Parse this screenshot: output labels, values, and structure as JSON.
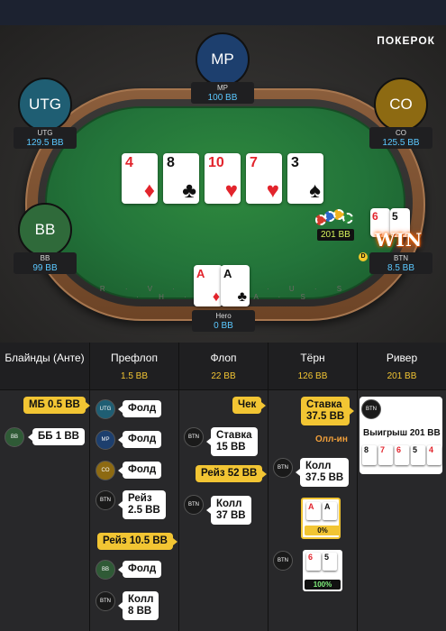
{
  "brand": "ПОКЕРОК",
  "rail_text": "R · V · S · P · U · S · H · C · A · S",
  "players": {
    "mp": {
      "abbr": "MP",
      "name": "MP",
      "stack": "100 BB",
      "color": "#1d3f6e"
    },
    "utg": {
      "abbr": "UTG",
      "name": "UTG",
      "stack": "129.5 BB",
      "color": "#1f5e73"
    },
    "co": {
      "abbr": "CO",
      "name": "CO",
      "stack": "125.5 BB",
      "color": "#8d6a12"
    },
    "bb": {
      "abbr": "BB",
      "name": "BB",
      "stack": "99 BB",
      "color": "#2f6a3a"
    },
    "btn": {
      "name": "BTN",
      "stack": "8.5 BB"
    },
    "hero": {
      "name": "Hero",
      "stack": "0 BB"
    }
  },
  "board": [
    {
      "rank": "4",
      "suit": "♦",
      "color": "red"
    },
    {
      "rank": "8",
      "suit": "♣",
      "color": "blk"
    },
    {
      "rank": "10",
      "suit": "♥",
      "color": "red"
    },
    {
      "rank": "7",
      "suit": "♥",
      "color": "red"
    },
    {
      "rank": "3",
      "suit": "♠",
      "color": "blk"
    }
  ],
  "hero_cards": [
    {
      "rank": "A",
      "suit": "♦",
      "color": "red"
    },
    {
      "rank": "A",
      "suit": "♣",
      "color": "blk"
    }
  ],
  "btn_cards": [
    {
      "rank": "6",
      "suit": "♥",
      "color": "red"
    },
    {
      "rank": "5",
      "suit": "♠",
      "color": "blk"
    }
  ],
  "pot": "201 BB",
  "win_text": "WIN",
  "dealer_label": "D",
  "history": {
    "columns": [
      {
        "title": "Блайнды (Анте)",
        "sub": ""
      },
      {
        "title": "Префлоп",
        "sub": "1.5 BB"
      },
      {
        "title": "Флоп",
        "sub": "22 BB"
      },
      {
        "title": "Тёрн",
        "sub": "126 BB"
      },
      {
        "title": "Ривер",
        "sub": "201 BB"
      }
    ],
    "blinds": {
      "sb": "МБ 0.5 BB",
      "bb_pos": "BB",
      "bb": "ББ 1 BB"
    },
    "preflop": [
      {
        "pos": "UTG",
        "action": "Фолд"
      },
      {
        "pos": "MP",
        "action": "Фолд"
      },
      {
        "pos": "CO",
        "action": "Фолд"
      },
      {
        "pos": "BTN",
        "action_line1": "Рейз",
        "action_line2": "2.5 BB"
      },
      {
        "hero_action": "Рейз 10.5 BB"
      },
      {
        "pos": "BB",
        "action": "Фолд"
      },
      {
        "pos": "BTN",
        "action_line1": "Колл",
        "action_line2": "8 BB"
      }
    ],
    "flop": [
      {
        "hero_action": "Чек"
      },
      {
        "pos": "BTN",
        "action_line1": "Ставка",
        "action_line2": "15 BB"
      },
      {
        "hero_action": "Рейз 52 BB"
      },
      {
        "pos": "BTN",
        "action_line1": "Колл",
        "action_line2": "37 BB"
      }
    ],
    "turn": {
      "hero_line1": "Ставка",
      "hero_line2": "37.5 BB",
      "allin": "Олл-ин",
      "btn_pos": "BTN",
      "btn_line1": "Колл",
      "btn_line2": "37.5 BB",
      "hero_equity": "0%",
      "btn_equity_pos": "BTN",
      "btn_equity": "100%"
    },
    "river": {
      "pos": "BTN",
      "win_label": "Выигрыш 201 BB"
    }
  }
}
